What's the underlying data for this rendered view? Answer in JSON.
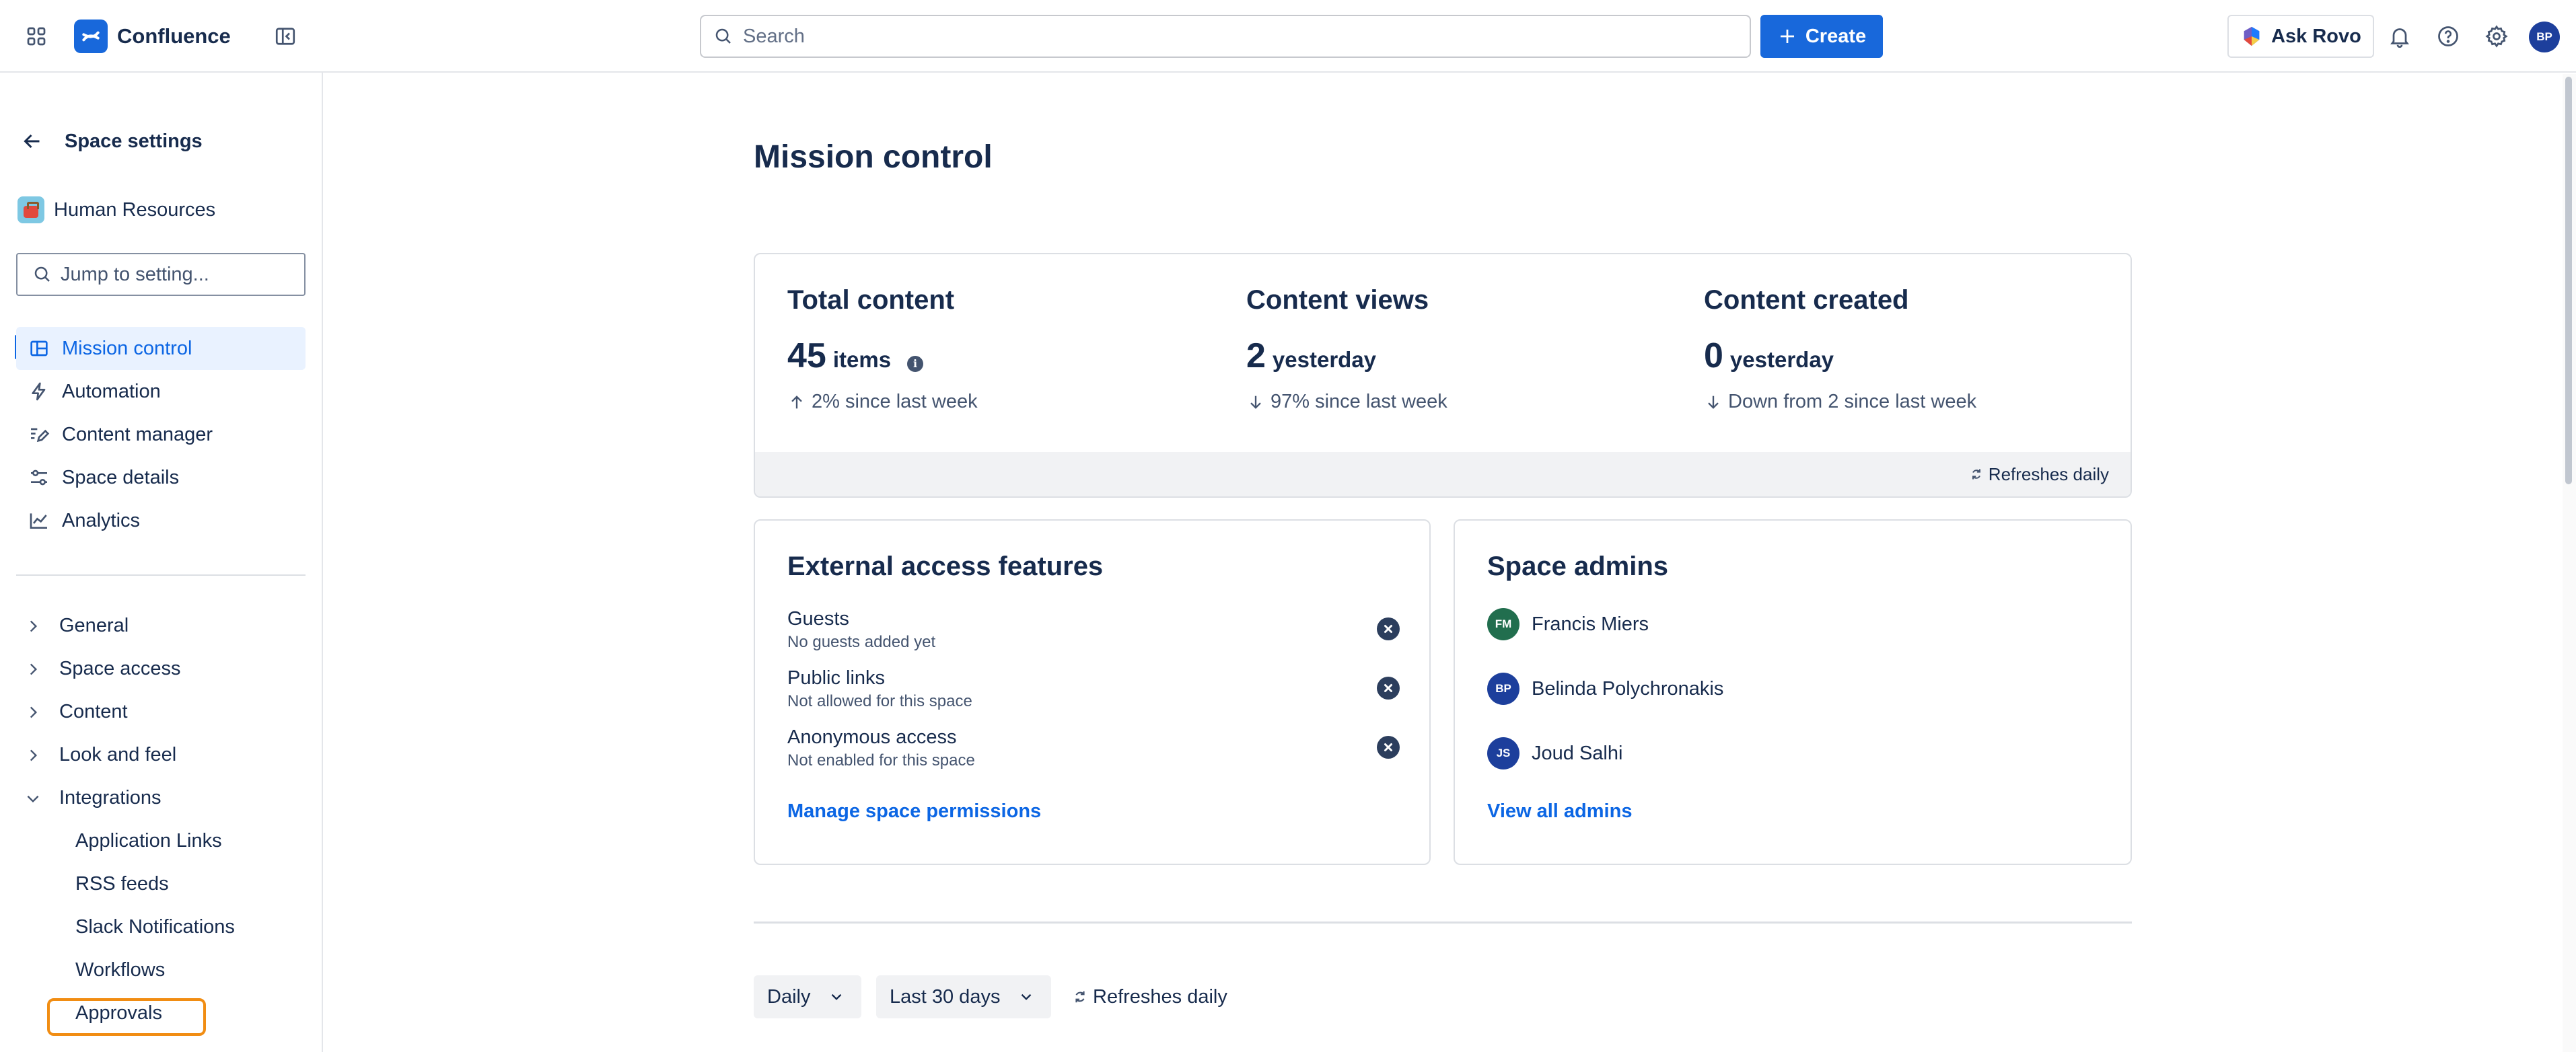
{
  "topbar": {
    "app_name": "Confluence",
    "search_placeholder": "Search",
    "create_label": "Create",
    "ask_rovo_label": "Ask Rovo",
    "user_initials": "BP"
  },
  "sidebar": {
    "back_label": "Space settings",
    "space_name": "Human Resources",
    "jump_placeholder": "Jump to setting...",
    "nav": [
      {
        "label": "Mission control",
        "icon": "layout-icon",
        "active": true
      },
      {
        "label": "Automation",
        "icon": "lightning-icon"
      },
      {
        "label": "Content manager",
        "icon": "edit-list-icon"
      },
      {
        "label": "Space details",
        "icon": "sliders-icon"
      },
      {
        "label": "Analytics",
        "icon": "line-chart-icon"
      }
    ],
    "sections": [
      {
        "label": "General",
        "expanded": false
      },
      {
        "label": "Space access",
        "expanded": false
      },
      {
        "label": "Content",
        "expanded": false
      },
      {
        "label": "Look and feel",
        "expanded": false
      },
      {
        "label": "Integrations",
        "expanded": true
      }
    ],
    "integrations": [
      "Application Links",
      "RSS feeds",
      "Slack Notifications",
      "Workflows",
      "Approvals"
    ]
  },
  "main": {
    "title": "Mission control",
    "stats": [
      {
        "label": "Total content",
        "value": "45",
        "unit": "items",
        "delta": "2% since last week",
        "direction": "up"
      },
      {
        "label": "Content views",
        "value": "2",
        "unit": "yesterday",
        "delta": "97% since last week",
        "direction": "down"
      },
      {
        "label": "Content created",
        "value": "0",
        "unit": "yesterday",
        "delta": "Down from 2 since last week",
        "direction": "down"
      }
    ],
    "stats_footer": "Refreshes daily",
    "external": {
      "title": "External access features",
      "features": [
        {
          "name": "Guests",
          "desc": "No guests added yet"
        },
        {
          "name": "Public links",
          "desc": "Not allowed for this space"
        },
        {
          "name": "Anonymous access",
          "desc": "Not enabled for this space"
        }
      ],
      "link": "Manage space permissions"
    },
    "admins": {
      "title": "Space admins",
      "people": [
        {
          "initials": "FM",
          "name": "Francis Miers",
          "color": "#216e4e"
        },
        {
          "initials": "BP",
          "name": "Belinda Polychronakis",
          "color": "#1d3f9c"
        },
        {
          "initials": "JS",
          "name": "Joud Salhi",
          "color": "#1d3f9c"
        }
      ],
      "link": "View all admins"
    },
    "filters": {
      "granularity": "Daily",
      "range": "Last 30 days",
      "refresh": "Refreshes daily"
    }
  },
  "colors": {
    "accent": "#1868db",
    "link": "#0c66e4",
    "highlight": "#f18d13"
  }
}
